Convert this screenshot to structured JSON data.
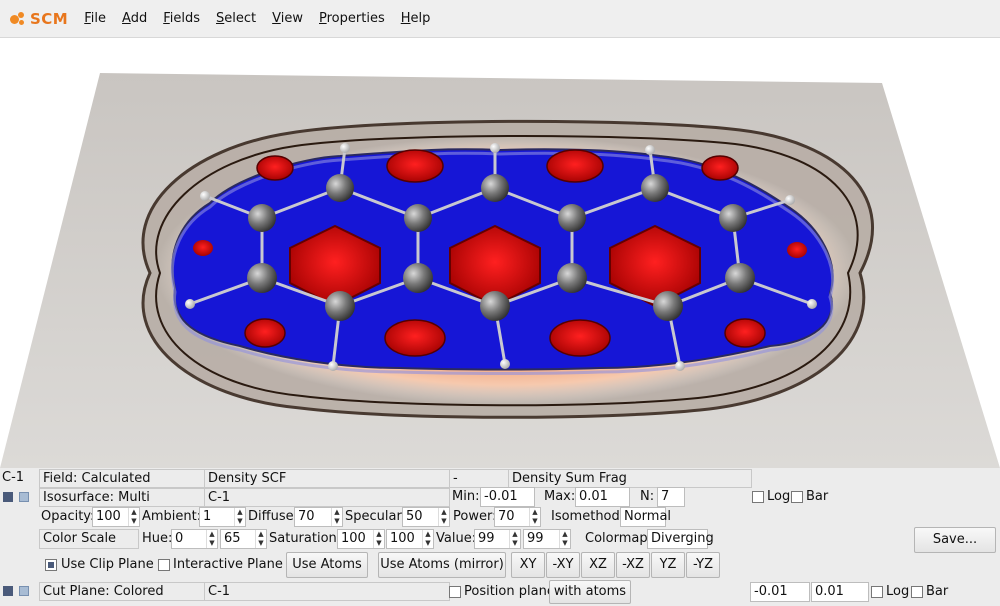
{
  "app": {
    "brand": "SCM"
  },
  "menu": [
    {
      "label": "File",
      "key": "F"
    },
    {
      "label": "Add",
      "key": "A"
    },
    {
      "label": "Fields",
      "key": "F"
    },
    {
      "label": "Select",
      "key": "S"
    },
    {
      "label": "View",
      "key": "V"
    },
    {
      "label": "Properties",
      "key": "P"
    },
    {
      "label": "Help",
      "key": "H"
    }
  ],
  "field_row": {
    "id": "C-1",
    "field": "Field: Calculated",
    "density": "Density SCF",
    "op": "-",
    "density2": "Density Sum Frag"
  },
  "iso_row": {
    "label": "Isosurface: Multi",
    "target": "C-1",
    "min_label": "Min:",
    "min": "-0.01",
    "max_label": "Max:",
    "max": "0.01",
    "n_label": "N:",
    "n": "7",
    "log": "Log",
    "bar": "Bar"
  },
  "material_row": {
    "opacity_label": "Opacity:",
    "opacity": "100",
    "ambient_label": "Ambient:",
    "ambient": "1",
    "diffuse_label": "Diffuse:",
    "diffuse": "70",
    "specular_label": "Specular:",
    "specular": "50",
    "power_label": "Power:",
    "power": "70",
    "isomethod_label": "Isomethod:",
    "isomethod": "Normal"
  },
  "color_row": {
    "label": "Color Scale",
    "hue_label": "Hue:",
    "hue1": "0",
    "hue2": "65",
    "sat_label": "Saturation:",
    "sat1": "100",
    "sat2": "100",
    "val_label": "Value:",
    "val1": "99",
    "val2": "99",
    "colormap_label": "Colormap:",
    "colormap": "Diverging",
    "save": "Save..."
  },
  "clip_row": {
    "use_clip": "Use Clip Plane",
    "interactive": "Interactive Plane",
    "use_atoms": "Use Atoms",
    "use_atoms_mirror": "Use Atoms (mirror)",
    "planes": [
      "XY",
      "-XY",
      "XZ",
      "-XZ",
      "YZ",
      "-YZ"
    ]
  },
  "cut_row": {
    "label": "Cut Plane: Colored",
    "target": "C-1",
    "position": "Position plane",
    "with_atoms": "with atoms",
    "min": "-0.01",
    "max": "0.01",
    "log": "Log",
    "bar": "Bar"
  },
  "colors": {
    "brand": "#e8761c",
    "negative": "#1414d8",
    "positive": "#d41414",
    "plane": "#d6d2ce"
  }
}
